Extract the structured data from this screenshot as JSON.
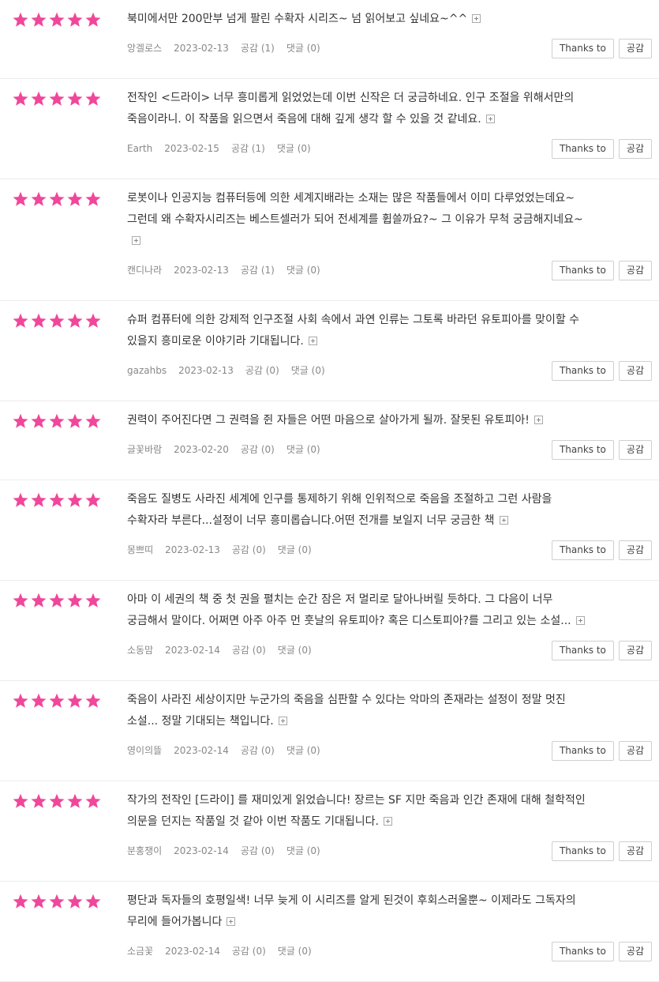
{
  "colors": {
    "star": "#f0479b"
  },
  "reviews": [
    {
      "rating": 5,
      "lines": [
        "북미에서만 200만부 넘게 팔린 수확자 시리즈~ 넘 읽어보고 싶네요~^^"
      ],
      "author": "앙겔로스",
      "date": "2023-02-13",
      "empathy": "공감 (1)",
      "comments": "댓글 (0)",
      "thanks_label": "Thanks to",
      "empathy_label": "공감"
    },
    {
      "rating": 5,
      "lines": [
        "전작인 <드라이> 너무 흥미롭게 읽었었는데 이번 신작은 더 궁금하네요. 인구 조절을 위해서만의",
        "죽음이라니. 이 작품을 읽으면서 죽음에 대해 깊게 생각 할 수 있을 것 같네요."
      ],
      "author": "Earth",
      "date": "2023-02-15",
      "empathy": "공감 (1)",
      "comments": "댓글 (0)",
      "thanks_label": "Thanks to",
      "empathy_label": "공감"
    },
    {
      "rating": 5,
      "lines": [
        "로봇이나 인공지능 컴퓨터등에 의한 세계지배라는 소재는 많은 작품들에서 이미 다루었었는데요~",
        "그런데 왜 수확자시리즈는 베스트셀러가 되어 전세계를 휩쓸까요?~ 그 이유가 무척 궁금해지네요~",
        ""
      ],
      "author": "캔디나라",
      "date": "2023-02-13",
      "empathy": "공감 (1)",
      "comments": "댓글 (0)",
      "thanks_label": "Thanks to",
      "empathy_label": "공감"
    },
    {
      "rating": 5,
      "lines": [
        "슈퍼 컴퓨터에 의한 강제적 인구조절 사회 속에서 과연 인류는 그토록 바라던 유토피아를 맞이할 수",
        "있을지 흥미로운 이야기라 기대됩니다."
      ],
      "author": "gazahbs",
      "date": "2023-02-13",
      "empathy": "공감 (0)",
      "comments": "댓글 (0)",
      "thanks_label": "Thanks to",
      "empathy_label": "공감"
    },
    {
      "rating": 5,
      "lines": [
        "권력이 주어진다면 그 권력을 쥔 자들은 어떤 마음으로 살아가게 될까. 잘못된 유토피아!"
      ],
      "author": "글꽃바람",
      "date": "2023-02-20",
      "empathy": "공감 (0)",
      "comments": "댓글 (0)",
      "thanks_label": "Thanks to",
      "empathy_label": "공감"
    },
    {
      "rating": 5,
      "lines": [
        "죽음도 질병도 사라진 세계에 인구를 통제하기 위해 인위적으로 죽음을 조절하고 그런 사람을",
        "수확자라 부른다...설정이 너무 흥미롭습니다.어떤 전개를 보일지 너무 궁금한 책"
      ],
      "author": "몽쁘띠",
      "date": "2023-02-13",
      "empathy": "공감 (0)",
      "comments": "댓글 (0)",
      "thanks_label": "Thanks to",
      "empathy_label": "공감"
    },
    {
      "rating": 5,
      "lines": [
        "아마 이 세권의 책 중 첫 권을 펼치는 순간 잠은 저 멀리로 달아나버릴 듯하다. 그 다음이 너무",
        "궁금해서 말이다. 어쩌면 아주 아주 먼 훗날의 유토피아? 혹은 디스토피아?를 그리고 있는 소설..."
      ],
      "author": "소동맘",
      "date": "2023-02-14",
      "empathy": "공감 (0)",
      "comments": "댓글 (0)",
      "thanks_label": "Thanks to",
      "empathy_label": "공감"
    },
    {
      "rating": 5,
      "lines": [
        "죽음이 사라진 세상이지만 누군가의 죽음을 심판할 수 있다는 악마의 존재라는 설정이 정말 멋진",
        "소설... 정말 기대되는 책입니다."
      ],
      "author": "영이의뜰",
      "date": "2023-02-14",
      "empathy": "공감 (0)",
      "comments": "댓글 (0)",
      "thanks_label": "Thanks to",
      "empathy_label": "공감"
    },
    {
      "rating": 5,
      "lines": [
        "작가의 전작인 [드라이] 를 재미있게 읽었습니다! 장르는 SF 지만 죽음과 인간 존재에 대해 철학적인",
        "의문을 던지는 작품일 것 같아 이번 작품도 기대됩니다."
      ],
      "author": "분홍쟁이",
      "date": "2023-02-14",
      "empathy": "공감 (0)",
      "comments": "댓글 (0)",
      "thanks_label": "Thanks to",
      "empathy_label": "공감"
    },
    {
      "rating": 5,
      "lines": [
        "평단과 독자들의 호평일색! 너무 늦게 이 시리즈를 알게 된것이 후회스러울뿐~ 이제라도 그독자의",
        "무리에 들어가봅니다"
      ],
      "author": "소금꽃",
      "date": "2023-02-14",
      "empathy": "공감 (0)",
      "comments": "댓글 (0)",
      "thanks_label": "Thanks to",
      "empathy_label": "공감"
    }
  ]
}
